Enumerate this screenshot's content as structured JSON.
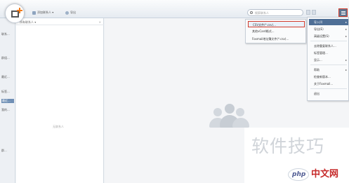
{
  "toolbar": {
    "item1_label": "添加联系人 ▾",
    "item2_label": "导出",
    "search_placeholder": "搜索联系人"
  },
  "sidebar": {
    "items": [
      {
        "label": "联系..."
      },
      {
        "label": "群组..."
      },
      {
        "label": "最近..."
      },
      {
        "label": "标签..."
      },
      {
        "label": "最近..."
      },
      {
        "label": "我的..."
      },
      {
        "label": "群..."
      }
    ]
  },
  "panel": {
    "header": "所有联系人 ▾",
    "close": "×",
    "empty_text": "无联系人"
  },
  "file_menu": {
    "items": [
      {
        "label": "CSV文件(*.csv)..."
      },
      {
        "label": "其他vCard格式..."
      },
      {
        "label": "Foxmail地址簿文件(*.csv)..."
      }
    ]
  },
  "main_menu": {
    "items": [
      {
        "label": "导入(I)"
      },
      {
        "label": "导出(E)"
      },
      {
        "label": "高级设置(S)"
      },
      {
        "label": "去除重复联系人..."
      },
      {
        "label": "标签管理..."
      },
      {
        "label": "显示..."
      },
      {
        "label": "帮助"
      },
      {
        "label": "检查新版本..."
      },
      {
        "label": "关于Foxmail..."
      },
      {
        "label": "退出"
      }
    ],
    "submenu_arrow": "▸"
  },
  "watermark": {
    "text": "软件技巧",
    "logo_text": "php",
    "site_text": "中文网"
  },
  "colors": {
    "accent": "#4f6f96",
    "highlight_border": "#d23b2b"
  }
}
